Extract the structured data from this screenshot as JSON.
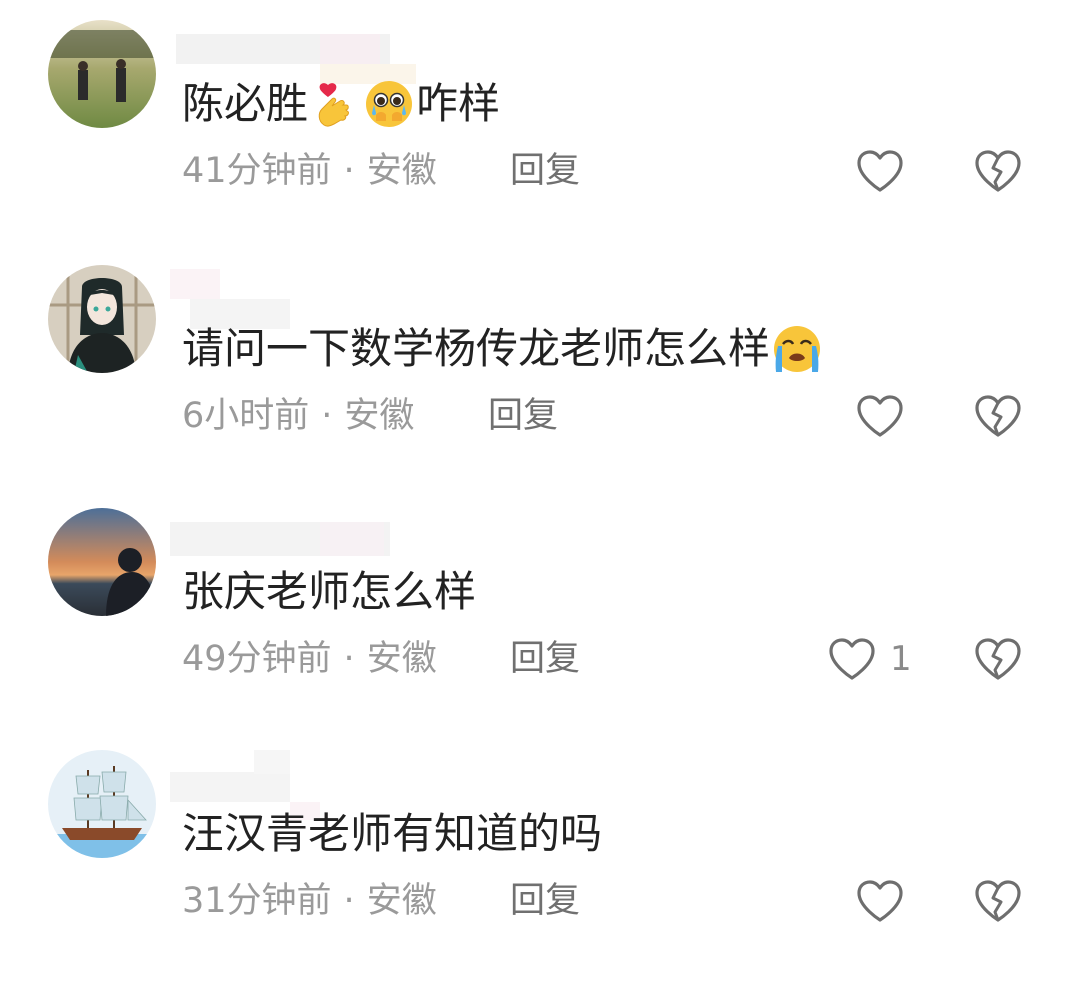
{
  "comments": [
    {
      "text_before": "陈必胜",
      "emojis": [
        "finger-heart-emoji",
        "pleading-face-emoji"
      ],
      "text_after": "咋样",
      "time": "41分钟前",
      "dot": "·",
      "location": "安徽",
      "reply_label": "回复",
      "like_count": ""
    },
    {
      "text_before": "请问一下数学杨传龙老师怎么样",
      "emojis": [
        "loudly-crying-face-emoji"
      ],
      "text_after": "",
      "time": "6小时前",
      "dot": "·",
      "location": "安徽",
      "reply_label": "回复",
      "like_count": ""
    },
    {
      "text_before": "张庆老师怎么样",
      "emojis": [],
      "text_after": "",
      "time": "49分钟前",
      "dot": "·",
      "location": "安徽",
      "reply_label": "回复",
      "like_count": "1"
    },
    {
      "text_before": "汪汉青老师有知道的吗",
      "emojis": [],
      "text_after": "",
      "time": "31分钟前",
      "dot": "·",
      "location": "安徽",
      "reply_label": "回复",
      "like_count": ""
    }
  ],
  "icons": {
    "like": "heart-outline-icon",
    "dislike": "broken-heart-outline-icon"
  },
  "colors": {
    "text": "#222222",
    "meta": "#9a9a9a",
    "reply": "#707070",
    "icon_stroke": "#6e6e6e"
  }
}
